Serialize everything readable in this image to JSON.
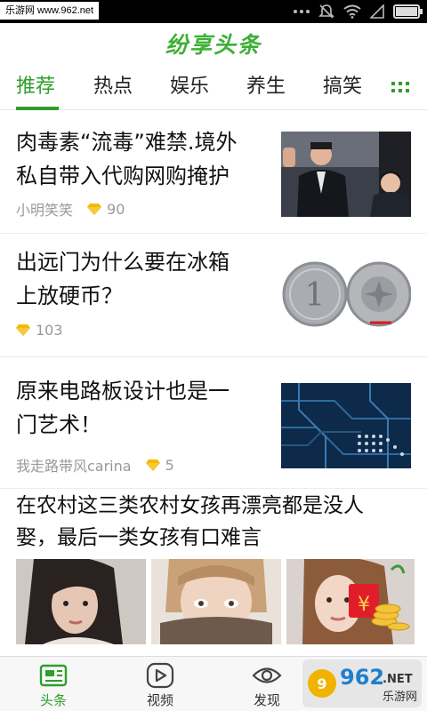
{
  "status_bar": {
    "watermark_text": "乐游网 www.962.net"
  },
  "header": {
    "app_name": "纷享头条"
  },
  "tabs": [
    {
      "label": "推荐"
    },
    {
      "label": "热点"
    },
    {
      "label": "娱乐"
    },
    {
      "label": "养生"
    },
    {
      "label": "搞笑"
    }
  ],
  "articles": [
    {
      "title_line1": "肉毒素“流毒”难禁.境外",
      "title_line2": "私自带入代购网购掩护",
      "author": "小明笑笑",
      "score": "90"
    },
    {
      "title_line1": "出远门为什么要在冰箱",
      "title_line2": "上放硬币？",
      "author": "",
      "score": "103"
    },
    {
      "title_line1": "原来电路板设计也是一",
      "title_line2": "门艺术！",
      "author": "我走路带风carina",
      "score": "5"
    },
    {
      "title_line1": "在农村这三类农村女孩再漂亮都是没人",
      "title_line2": "娶，最后一类女孩有口难言"
    }
  ],
  "coin_text": "1",
  "bottom_nav": [
    {
      "label": "头条",
      "icon": "news-icon"
    },
    {
      "label": "视频",
      "icon": "play-icon"
    },
    {
      "label": "发现",
      "icon": "eye-icon"
    }
  ],
  "corner_watermark": {
    "digits": "962",
    "suffix": ".NET",
    "sub": "乐游网"
  },
  "colors": {
    "accent": "#2f9e2a",
    "logo": "#3cb035",
    "gem": "#f5b800",
    "meta": "#999999"
  }
}
